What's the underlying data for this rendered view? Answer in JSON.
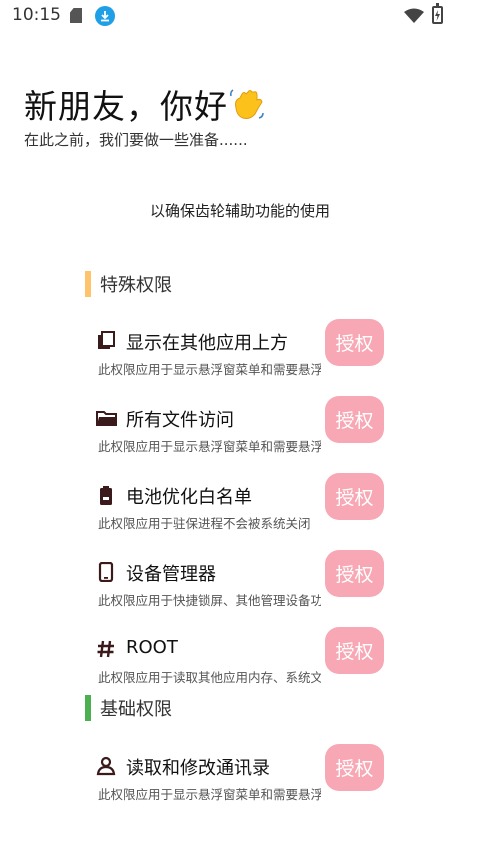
{
  "status_bar": {
    "time": "10:15"
  },
  "header": {
    "greeting": "新朋友，你好",
    "subtitle": "在此之前，我们要做一些准备......",
    "purpose": "以确保齿轮辅助功能的使用"
  },
  "sections": {
    "special": {
      "title": "特殊权限",
      "color": "#ffc46b"
    },
    "basic": {
      "title": "基础权限",
      "color": "#4caf50"
    }
  },
  "permissions": [
    {
      "title": "显示在其他应用上方",
      "desc": "此权限应用于显示悬浮窗菜单和需要悬浮窗的功能",
      "icon": "layers-icon",
      "button": "授权"
    },
    {
      "title": "所有文件访问",
      "desc": "此权限应用于显示悬浮窗菜单和需要悬浮窗的功能",
      "icon": "folder-icon",
      "button": "授权"
    },
    {
      "title": "电池优化白名单",
      "desc": "此权限应用于驻保进程不会被系统关闭",
      "icon": "battery-icon",
      "button": "授权"
    },
    {
      "title": "设备管理器",
      "desc": "此权限应用于快捷锁屏、其他管理设备功能",
      "icon": "phone-icon",
      "button": "授权"
    },
    {
      "title": "ROOT",
      "desc": "此权限应用于读取其他应用内存、系统文件",
      "icon": "hash-icon",
      "button": "授权"
    },
    {
      "title": "读取和修改通讯录",
      "desc": "此权限应用于显示悬浮窗菜单和需要悬浮窗的功能",
      "icon": "contact-icon",
      "button": "授权"
    }
  ],
  "colors": {
    "accent_button": "#f7a8b4",
    "icon_color": "#3a1a1a"
  }
}
